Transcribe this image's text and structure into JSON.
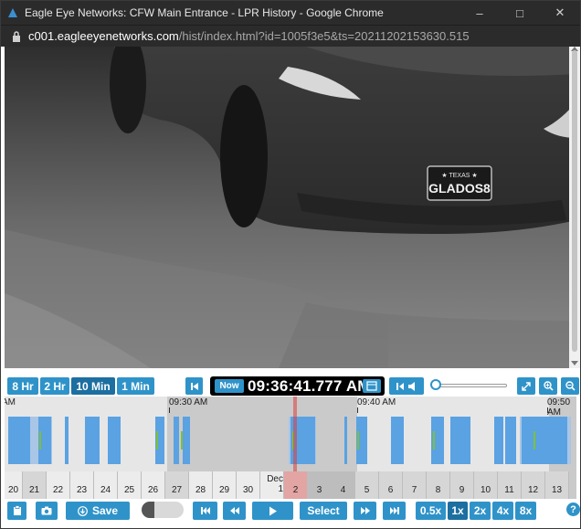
{
  "window": {
    "title": "Eagle Eye Networks: CFW Main Entrance - LPR History - Google Chrome",
    "minimize": "–",
    "maximize": "□",
    "close": "✕"
  },
  "address": {
    "host": "c001.eagleeyenetworks.com",
    "path": "/hist/index.html?id=1005f3e5&ts=20211202153630.515"
  },
  "plate": {
    "state": "★ TEXAS ★",
    "number": "GLADOS8"
  },
  "toolbar": {
    "ranges": [
      "8 Hr",
      "2 Hr",
      "10 Min",
      "1 Min"
    ],
    "active_range": "10 Min",
    "now_label": "Now",
    "time": "09:36:41.777 AM"
  },
  "timeline": {
    "labels": [
      {
        "text": "AM"
      },
      {
        "text": "09:30 AM"
      },
      {
        "text": "09:40 AM"
      },
      {
        "text": "09:50 AM"
      }
    ]
  },
  "days": {
    "nov": [
      "20",
      "21",
      "22",
      "23",
      "24",
      "25",
      "26",
      "27",
      "28",
      "29",
      "30"
    ],
    "dec_label": "Dec",
    "dec": [
      "1",
      "2",
      "3",
      "4",
      "5",
      "6",
      "7",
      "8",
      "9",
      "10",
      "11",
      "12",
      "13"
    ]
  },
  "controls": {
    "save_label": "Save",
    "select_label": "Select",
    "speeds": [
      "0.5x",
      "1x",
      "2x",
      "4x",
      "8x"
    ],
    "active_speed": "1x",
    "help": "?"
  },
  "colors": {
    "accent": "#2f93c9",
    "recording": "#5aa2e2",
    "motion": "#7fbf3a",
    "playhead": "#dc3c3c"
  }
}
